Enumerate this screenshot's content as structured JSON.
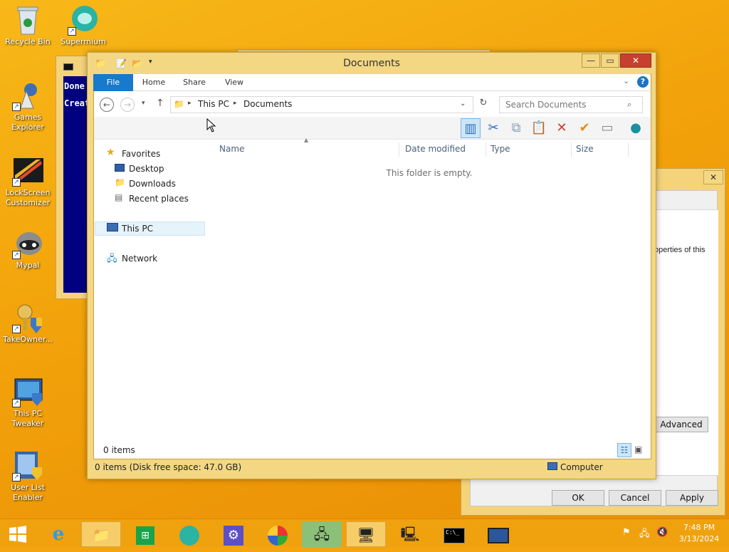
{
  "desktop_icons": [
    {
      "label": "Recycle Bin",
      "name": "recycle-bin-icon"
    },
    {
      "label": "Supermium",
      "name": "supermium-icon"
    },
    {
      "label": "Games Explorer",
      "name": "games-explorer-icon"
    },
    {
      "label": "LockScreen Customizer",
      "name": "lockscreen-customizer-icon"
    },
    {
      "label": "Mypal",
      "name": "mypal-icon"
    },
    {
      "label": "TakeOwner...",
      "name": "takeowner-icon"
    },
    {
      "label": "This PC Tweaker",
      "name": "this-pc-tweaker-icon"
    },
    {
      "label": "User List Enabler",
      "name": "user-list-enabler-icon"
    }
  ],
  "cmd": {
    "line1": "Done",
    "line2": "Creat"
  },
  "explorer": {
    "title": "Documents",
    "tabs": {
      "file": "File",
      "home": "Home",
      "share": "Share",
      "view": "View"
    },
    "address": {
      "seg1": "This PC",
      "seg2": "Documents"
    },
    "search_placeholder": "Search Documents",
    "nav": {
      "favorites": "Favorites",
      "desktop": "Desktop",
      "downloads": "Downloads",
      "recent": "Recent places",
      "thispc": "This PC",
      "network": "Network"
    },
    "columns": {
      "name": "Name",
      "date": "Date modified",
      "type": "Type",
      "size": "Size"
    },
    "empty": "This folder is empty.",
    "item_count": "0 items",
    "status_left": "0 items (Disk free space: 47.0 GB)",
    "status_right": "Computer"
  },
  "dialog": {
    "text": "operties of this",
    "advanced": "Advanced",
    "ok": "OK",
    "cancel": "Cancel",
    "apply": "Apply"
  },
  "clock": {
    "time": "7:48 PM",
    "date": "3/13/2024"
  }
}
